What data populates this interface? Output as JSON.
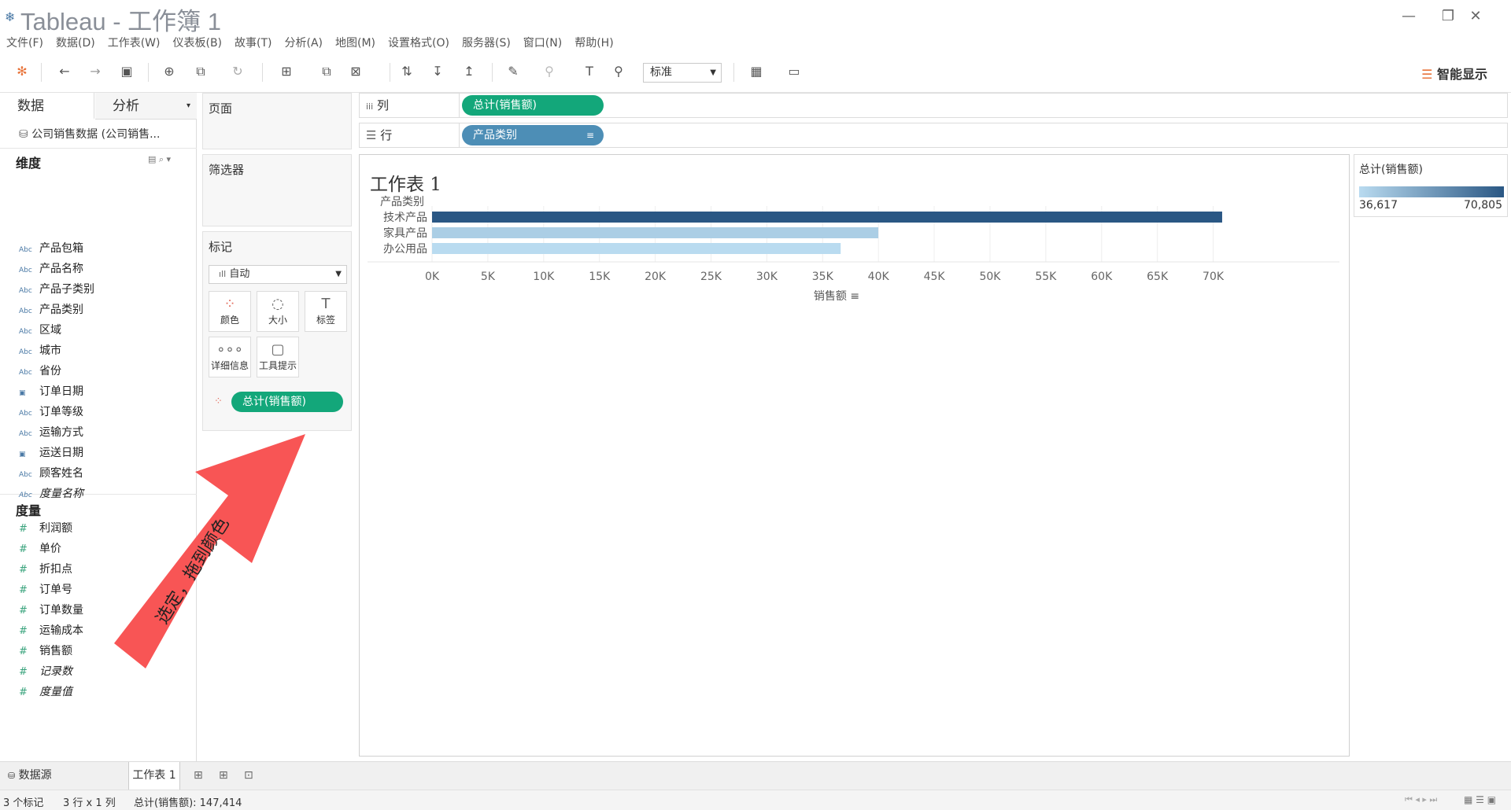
{
  "app": {
    "title": "Tableau - 工作簿 1"
  },
  "menu": [
    "文件(F)",
    "数据(D)",
    "工作表(W)",
    "仪表板(B)",
    "故事(T)",
    "分析(A)",
    "地图(M)",
    "设置格式(O)",
    "服务器(S)",
    "窗口(N)",
    "帮助(H)"
  ],
  "toolbar": {
    "fit_select": "标准",
    "smart_show": "智能显示"
  },
  "left": {
    "tab_data": "数据",
    "tab_analysis": "分析",
    "datasource": "公司销售数据 (公司销售...",
    "dimensions_title": "维度",
    "dimensions": [
      {
        "label": "产品包箱",
        "type": "Abc"
      },
      {
        "label": "产品名称",
        "type": "Abc"
      },
      {
        "label": "产品子类别",
        "type": "Abc"
      },
      {
        "label": "产品类别",
        "type": "Abc"
      },
      {
        "label": "区域",
        "type": "Abc"
      },
      {
        "label": "城市",
        "type": "Abc"
      },
      {
        "label": "省份",
        "type": "Abc"
      },
      {
        "label": "订单日期",
        "type": "date"
      },
      {
        "label": "订单等级",
        "type": "Abc"
      },
      {
        "label": "运输方式",
        "type": "Abc"
      },
      {
        "label": "运送日期",
        "type": "date"
      },
      {
        "label": "顾客姓名",
        "type": "Abc"
      },
      {
        "label": "度量名称",
        "type": "Abc",
        "italic": true
      }
    ],
    "measures_title": "度量",
    "measures": [
      {
        "label": "利润额"
      },
      {
        "label": "单价"
      },
      {
        "label": "折扣点"
      },
      {
        "label": "订单号"
      },
      {
        "label": "订单数量"
      },
      {
        "label": "运输成本"
      },
      {
        "label": "销售额"
      },
      {
        "label": "记录数",
        "italic": true
      },
      {
        "label": "度量值",
        "italic": true
      }
    ]
  },
  "cards": {
    "pages": "页面",
    "filters": "筛选器",
    "marks": "标记",
    "mark_type": "自动",
    "mark_buttons": [
      "颜色",
      "大小",
      "标签",
      "详细信息",
      "工具提示"
    ],
    "color_pill": "总计(销售额)"
  },
  "shelves": {
    "columns_label": "列",
    "rows_label": "行",
    "columns_pill": "总计(销售额)",
    "rows_pill": "产品类别"
  },
  "worksheet": {
    "title": "工作表 1"
  },
  "chart_data": {
    "type": "bar",
    "orientation": "horizontal",
    "row_header": "产品类别",
    "categories": [
      "技术产品",
      "家具产品",
      "办公用品"
    ],
    "values": [
      70805,
      39992,
      36617
    ],
    "xlabel": "销售额",
    "xlim": [
      0,
      72500
    ],
    "ticks": [
      "0K",
      "5K",
      "10K",
      "15K",
      "20K",
      "25K",
      "30K",
      "35K",
      "40K",
      "45K",
      "50K",
      "55K",
      "60K",
      "65K",
      "70K"
    ],
    "tick_values": [
      0,
      5000,
      10000,
      15000,
      20000,
      25000,
      30000,
      35000,
      40000,
      45000,
      50000,
      55000,
      60000,
      65000,
      70000
    ],
    "color_min": "#b9dbf0",
    "color_max": "#2a5784",
    "grid": true
  },
  "legend": {
    "title": "总计(销售额)",
    "min": "36,617",
    "max": "70,805"
  },
  "annotation": {
    "text": "选定，拖到颜色",
    "color": "#f85555"
  },
  "bottom": {
    "datasource_tab": "数据源",
    "sheet_tab": "工作表 1"
  },
  "status": {
    "marks": "3 个标记",
    "rows_cols": "3 行 x 1 列",
    "sum": "总计(销售额): 147,414"
  }
}
